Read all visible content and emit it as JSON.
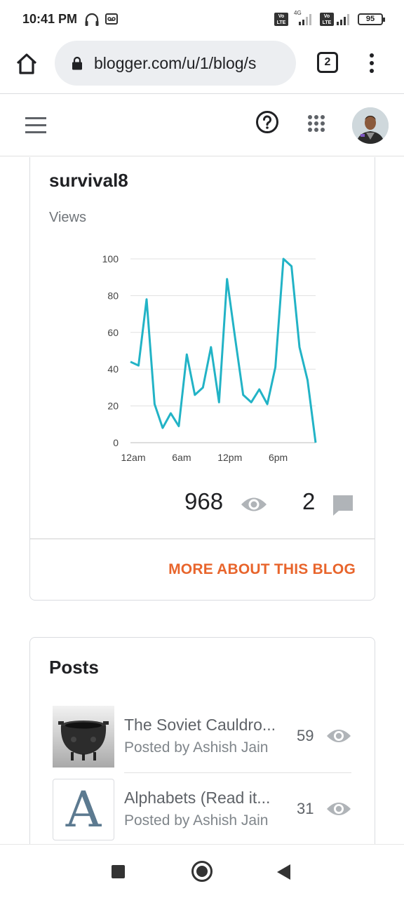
{
  "status_bar": {
    "time": "10:41 PM",
    "battery": "95",
    "volte_label": "Vo LTE",
    "network": "4G"
  },
  "browser": {
    "url": "blogger.com/u/1/blog/s",
    "tab_count": "2"
  },
  "blog": {
    "title": "survival8",
    "views_label": "Views",
    "views_total": "968",
    "comments_total": "2",
    "more_link": "MORE ABOUT THIS BLOG"
  },
  "chart_data": {
    "type": "line",
    "x": [
      0,
      1,
      2,
      3,
      4,
      5,
      6,
      7,
      8,
      9,
      10,
      11,
      12,
      13,
      14,
      15,
      16,
      17,
      18,
      19,
      20,
      21,
      22,
      23
    ],
    "xticks": [
      "12am",
      "6am",
      "12pm",
      "6pm"
    ],
    "xtick_positions": [
      0,
      6,
      12,
      18
    ],
    "yticks": [
      "0",
      "20",
      "40",
      "60",
      "80",
      "100"
    ],
    "ylim": [
      0,
      100
    ],
    "series": [
      {
        "values": [
          44,
          42,
          78,
          21,
          8,
          16,
          9,
          48,
          26,
          30,
          52,
          22,
          89,
          57,
          26,
          22,
          29,
          21,
          41,
          100,
          96,
          52,
          34,
          0
        ]
      }
    ],
    "line_color": "#22b3c6",
    "grid": true
  },
  "posts": {
    "title": "Posts",
    "items": [
      {
        "title": "The Soviet Cauldro...",
        "author": "Posted by Ashish Jain",
        "views": "59"
      },
      {
        "title": "Alphabets (Read it...",
        "author": "Posted by Ashish Jain",
        "views": "31"
      }
    ],
    "letter_thumb": "A"
  },
  "icons": {
    "home": "home-icon",
    "lock": "lock-icon",
    "menu": "hamburger-icon",
    "help": "help-icon",
    "apps": "apps-grid-icon",
    "views": "eye-icon",
    "comments": "comment-icon"
  }
}
